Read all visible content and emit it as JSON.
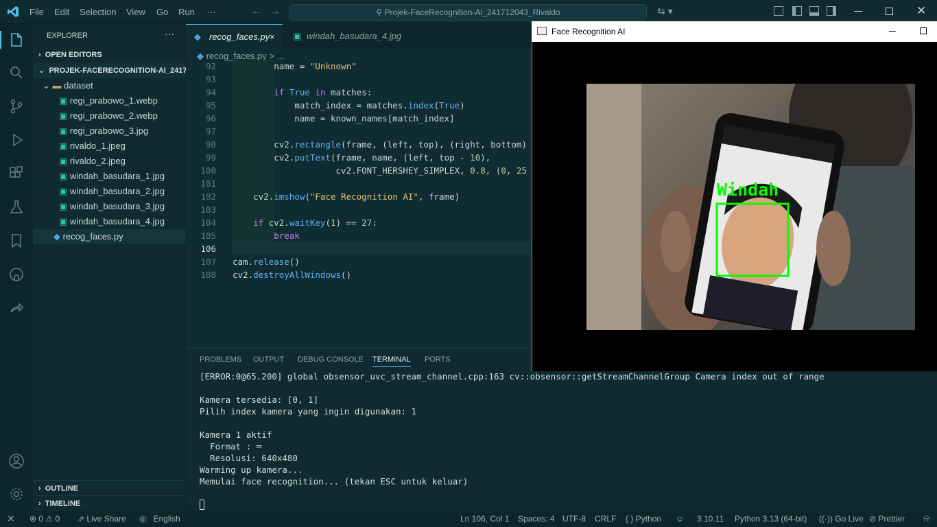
{
  "titlebar": {
    "menus": [
      "File",
      "Edit",
      "Selection",
      "View",
      "Go",
      "Run",
      "···"
    ],
    "search": "Projek-FaceRecognition-Ai_241712043_Rivaldo"
  },
  "sidebar": {
    "title": "EXPLORER",
    "open_editors": "OPEN EDITORS",
    "project": "PROJEK-FACERECOGNITION-AI_2417...",
    "folder": "dataset",
    "files": [
      "regi_prabowo_1.webp",
      "regi_prabowo_2.webp",
      "regi_prabowo_3.jpg",
      "rivaldo_1.jpeg",
      "rivaldo_2.jpeg",
      "windah_basudara_1.jpg",
      "windah_basudara_2.jpg",
      "windah_basudara_3.jpg",
      "windah_basudara_4.jpg"
    ],
    "script": "recog_faces.py",
    "outline": "OUTLINE",
    "timeline": "TIMELINE"
  },
  "editor": {
    "tabs": [
      {
        "label": "recog_faces.py",
        "close": "×"
      },
      {
        "label": "windah_basudara_4.jpg"
      }
    ],
    "breadcrumb": "recog_faces.py > ...",
    "lines": [
      {
        "n": "92",
        "t": "        name = \"Unknown\""
      },
      {
        "n": "93",
        "t": ""
      },
      {
        "n": "94",
        "t": "        if True in matches:"
      },
      {
        "n": "95",
        "t": "            match_index = matches.index(True)"
      },
      {
        "n": "96",
        "t": "            name = known_names[match_index]"
      },
      {
        "n": "97",
        "t": ""
      },
      {
        "n": "98",
        "t": "        cv2.rectangle(frame, (left, top), (right, bottom)"
      },
      {
        "n": "99",
        "t": "        cv2.putText(frame, name, (left, top - 10),"
      },
      {
        "n": "100",
        "t": "                    cv2.FONT_HERSHEY_SIMPLEX, 0.8, (0, 25"
      },
      {
        "n": "101",
        "t": ""
      },
      {
        "n": "102",
        "t": "    cv2.imshow(\"Face Recognition AI\", frame)"
      },
      {
        "n": "103",
        "t": ""
      },
      {
        "n": "104",
        "t": "    if cv2.waitKey(1) == 27:"
      },
      {
        "n": "105",
        "t": "        break"
      },
      {
        "n": "106",
        "t": ""
      },
      {
        "n": "107",
        "t": "cam.release()"
      },
      {
        "n": "108",
        "t": "cv2.destroyAllWindows()"
      }
    ]
  },
  "panel": {
    "tabs": [
      "PROBLEMS",
      "OUTPUT",
      "DEBUG CONSOLE",
      "TERMINAL",
      "PORTS"
    ],
    "terminal": [
      "[ERROR:0@65.200] global obsensor_uvc_stream_channel.cpp:163 cv::obsensor::getStreamChannelGroup Camera index out of range",
      "",
      "Kamera tersedia: [0, 1]",
      "Pilih index kamera yang ingin digunakan: 1",
      "",
      "Kamera 1 aktif",
      "  Format : ═",
      "  Resolusi: 640x480",
      "Warming up kamera...",
      "Memulai face recognition... (tekan ESC untuk keluar)"
    ]
  },
  "status": {
    "errors": "0",
    "warnings": "0",
    "liveshare": "Live Share",
    "lang": "English",
    "pos": "Ln 106, Col 1",
    "spaces": "Spaces: 4",
    "enc": "UTF-8",
    "eol": "CRLF",
    "mode": "Python",
    "ver": "3.10.11",
    "interp": "Python 3.13 (64-bit)",
    "golive": "Go Live",
    "prettier": "Prettier"
  },
  "window": {
    "title": "Face Recognition AI",
    "label": "Windah"
  },
  "colors": {
    "accent": "#4fc1e9",
    "box": "#00ff00"
  }
}
